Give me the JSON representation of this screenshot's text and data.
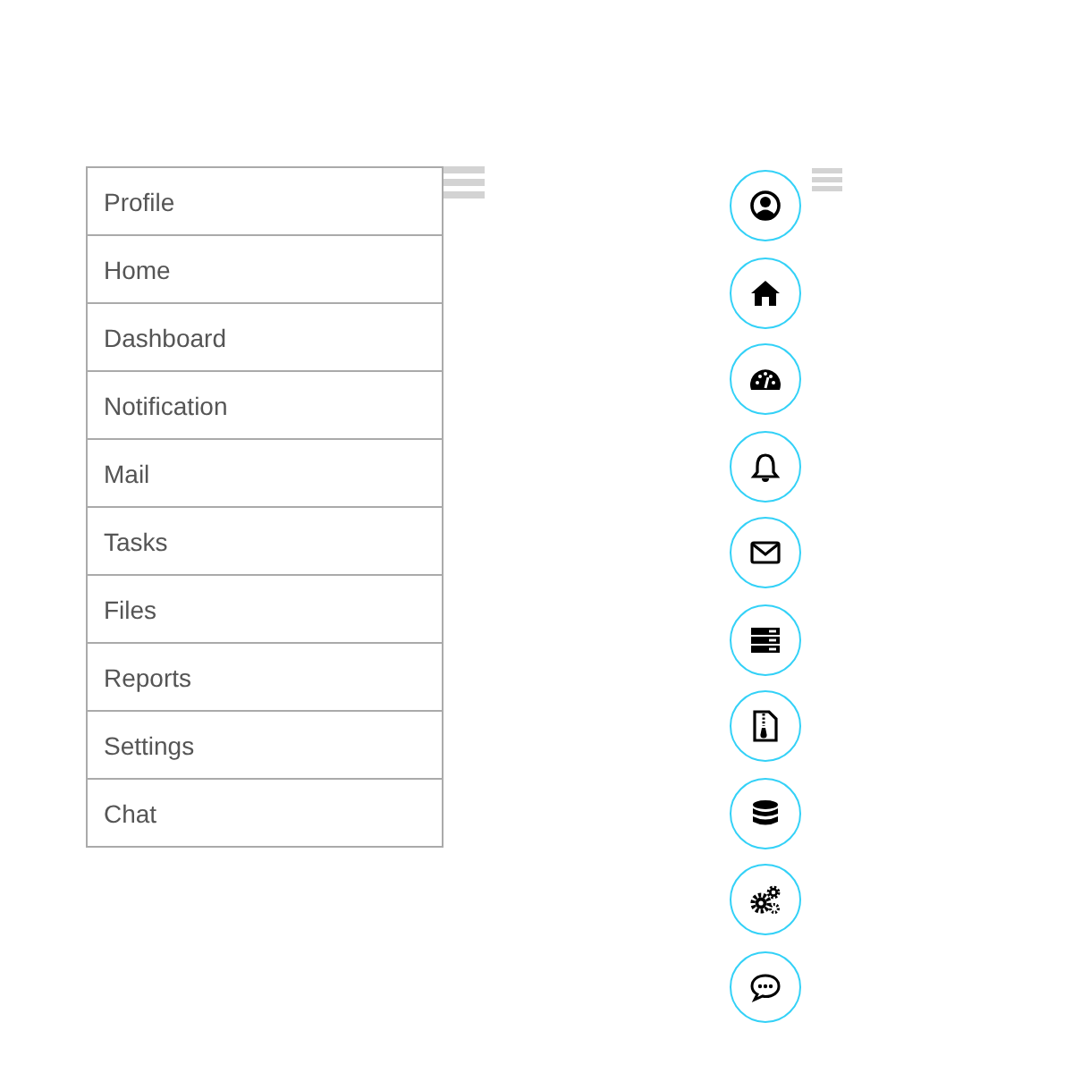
{
  "menu": {
    "items": [
      {
        "label": "Profile"
      },
      {
        "label": "Home"
      },
      {
        "label": "Dashboard"
      },
      {
        "label": "Notification"
      },
      {
        "label": "Mail"
      },
      {
        "label": "Tasks"
      },
      {
        "label": "Files"
      },
      {
        "label": "Reports"
      },
      {
        "label": "Settings"
      },
      {
        "label": "Chat"
      }
    ]
  },
  "rail": {
    "items": [
      {
        "kind": "user"
      },
      {
        "kind": "home"
      },
      {
        "kind": "gauge"
      },
      {
        "kind": "bell"
      },
      {
        "kind": "mail"
      },
      {
        "kind": "server"
      },
      {
        "kind": "file"
      },
      {
        "kind": "database"
      },
      {
        "kind": "gears"
      },
      {
        "kind": "chat"
      }
    ]
  }
}
